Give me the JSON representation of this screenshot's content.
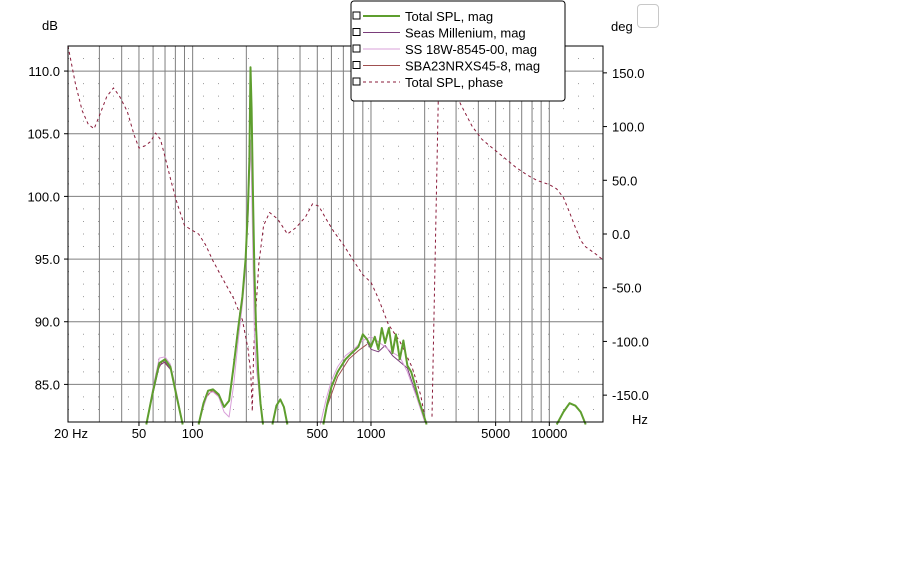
{
  "chart_data": {
    "type": "line",
    "xscale": "log",
    "xlim": [
      20,
      20000
    ],
    "ylim": [
      82,
      112
    ],
    "y2lim": [
      -175,
      175
    ],
    "grid": true,
    "legend_position": "top-right",
    "yunit": "dB",
    "y2unit": "deg",
    "xunit": "Hz",
    "colors": {
      "total_mag": "#5e9e2e",
      "seas": "#7a3d7a",
      "ss": "#d9a0d9",
      "sba": "#a05050",
      "phase": "#8a1b3a"
    },
    "x_ticks": [
      {
        "value": 20,
        "label": "20 Hz"
      },
      {
        "value": 50,
        "label": "50"
      },
      {
        "value": 100,
        "label": "100"
      },
      {
        "value": 500,
        "label": "500"
      },
      {
        "value": 1000,
        "label": "1000"
      },
      {
        "value": 5000,
        "label": "5000"
      },
      {
        "value": 10000,
        "label": "10000"
      }
    ],
    "y_ticks": [
      {
        "value": 110,
        "label": "110.0"
      },
      {
        "value": 105,
        "label": "105.0"
      },
      {
        "value": 100,
        "label": "100.0"
      },
      {
        "value": 95,
        "label": "95.0"
      },
      {
        "value": 90,
        "label": "90.0"
      },
      {
        "value": 85,
        "label": "85.0"
      }
    ],
    "y2_ticks": [
      {
        "value": 150,
        "label": "150.0"
      },
      {
        "value": 100,
        "label": "100.0"
      },
      {
        "value": 50,
        "label": "50.0"
      },
      {
        "value": 0,
        "label": "0.0"
      },
      {
        "value": -50,
        "label": "-50.0"
      },
      {
        "value": -100,
        "label": "-100.0"
      },
      {
        "value": -150,
        "label": "-150.0"
      }
    ],
    "series": [
      {
        "name": "Total SPL, mag",
        "color_key": "total_mag",
        "axis": "left",
        "style": "solid",
        "segments": [
          [
            [
              55,
              81.8
            ],
            [
              60,
              84.5
            ],
            [
              65,
              86.7
            ],
            [
              70,
              87.0
            ],
            [
              75,
              86.4
            ],
            [
              80,
              84.5
            ],
            [
              88,
              81.8
            ]
          ],
          [
            [
              108,
              81.8
            ],
            [
              115,
              83.5
            ],
            [
              122,
              84.5
            ],
            [
              130,
              84.6
            ],
            [
              140,
              84.2
            ],
            [
              150,
              83.2
            ],
            [
              160,
              83.7
            ],
            [
              170,
              86.5
            ],
            [
              180,
              89.5
            ],
            [
              190,
              92.0
            ],
            [
              198,
              95.0
            ],
            [
              204,
              99.0
            ],
            [
              208,
              103.0
            ],
            [
              211,
              110.3
            ],
            [
              214,
              107.0
            ],
            [
              218,
              100.0
            ],
            [
              222,
              94.0
            ],
            [
              227,
              89.5
            ],
            [
              233,
              86.0
            ],
            [
              240,
              83.5
            ],
            [
              248,
              81.8
            ]
          ],
          [
            [
              280,
              81.8
            ],
            [
              295,
              83.3
            ],
            [
              310,
              83.8
            ],
            [
              325,
              83.2
            ],
            [
              340,
              81.8
            ]
          ],
          [
            [
              540,
              81.8
            ],
            [
              570,
              83.5
            ],
            [
              600,
              84.8
            ],
            [
              650,
              86.0
            ],
            [
              720,
              87.0
            ],
            [
              780,
              87.5
            ],
            [
              850,
              88.0
            ],
            [
              900,
              89.0
            ],
            [
              950,
              88.6
            ],
            [
              1000,
              88.0
            ],
            [
              1050,
              88.8
            ],
            [
              1100,
              87.8
            ],
            [
              1150,
              89.5
            ],
            [
              1200,
              88.3
            ],
            [
              1260,
              89.5
            ],
            [
              1320,
              87.5
            ],
            [
              1380,
              89.0
            ],
            [
              1450,
              87.0
            ],
            [
              1520,
              88.5
            ],
            [
              1600,
              86.5
            ],
            [
              1680,
              86.0
            ],
            [
              1760,
              85.0
            ],
            [
              1850,
              83.8
            ],
            [
              1950,
              82.8
            ],
            [
              2050,
              81.8
            ]
          ],
          [
            [
              11000,
              81.8
            ],
            [
              12000,
              82.8
            ],
            [
              13000,
              83.5
            ],
            [
              14000,
              83.3
            ],
            [
              15000,
              82.8
            ],
            [
              16000,
              81.8
            ]
          ]
        ]
      },
      {
        "name": "Seas Millenium, mag",
        "color_key": "seas",
        "axis": "left",
        "style": "solid",
        "segments": [
          [
            [
              60,
              84.3
            ],
            [
              65,
              86.5
            ],
            [
              70,
              86.8
            ],
            [
              75,
              86.2
            ]
          ],
          [
            [
              950,
              88.4
            ],
            [
              1000,
              87.8
            ],
            [
              1100,
              87.6
            ],
            [
              1200,
              88.1
            ],
            [
              1320,
              87.3
            ],
            [
              1450,
              86.8
            ],
            [
              1600,
              86.3
            ],
            [
              1850,
              83.6
            ],
            [
              2050,
              81.9
            ]
          ]
        ]
      },
      {
        "name": "SS 18W-8545-00, mag",
        "color_key": "ss",
        "axis": "left",
        "style": "solid",
        "segments": [
          [
            [
              55,
              81.8
            ],
            [
              60,
              84.8
            ],
            [
              65,
              87.1
            ],
            [
              70,
              87.2
            ],
            [
              75,
              86.6
            ],
            [
              80,
              84.8
            ],
            [
              88,
              81.9
            ]
          ],
          [
            [
              108,
              81.8
            ],
            [
              115,
              83.2
            ],
            [
              122,
              84.3
            ],
            [
              130,
              84.4
            ],
            [
              140,
              84.0
            ],
            [
              150,
              82.8
            ],
            [
              160,
              82.4
            ],
            [
              170,
              85.0
            ],
            [
              180,
              88.5
            ],
            [
              190,
              91.4
            ],
            [
              198,
              94.2
            ],
            [
              204,
              98.0
            ],
            [
              208,
              101.5
            ],
            [
              211,
              104.5
            ],
            [
              214,
              101.0
            ],
            [
              218,
              95.0
            ],
            [
              222,
              89.0
            ],
            [
              227,
              86.5
            ],
            [
              233,
              85.0
            ],
            [
              240,
              83.2
            ],
            [
              248,
              81.8
            ]
          ],
          [
            [
              520,
              81.8
            ],
            [
              560,
              83.8
            ],
            [
              600,
              85.3
            ],
            [
              650,
              86.4
            ],
            [
              720,
              87.3
            ],
            [
              800,
              87.8
            ],
            [
              900,
              88.5
            ],
            [
              1000,
              88.8
            ],
            [
              1100,
              88.4
            ],
            [
              1200,
              88.0
            ],
            [
              1300,
              87.6
            ],
            [
              1450,
              87.2
            ],
            [
              1600,
              86.0
            ],
            [
              1800,
              84.0
            ],
            [
              2000,
              82.0
            ]
          ]
        ]
      },
      {
        "name": "SBA23NRXS45-8, mag",
        "color_key": "sba",
        "axis": "left",
        "style": "solid",
        "segments": [
          [
            [
              62,
              85.8
            ],
            [
              68,
              86.9
            ],
            [
              74,
              86.3
            ]
          ],
          [
            [
              118,
              83.9
            ],
            [
              128,
              84.5
            ],
            [
              140,
              84.1
            ]
          ],
          [
            [
              560,
              83.0
            ],
            [
              650,
              85.6
            ],
            [
              750,
              87.0
            ],
            [
              850,
              87.7
            ],
            [
              950,
              88.2
            ]
          ]
        ]
      },
      {
        "name": "Total SPL, phase",
        "color_key": "phase",
        "axis": "right",
        "style": "dashed",
        "segments": [
          [
            [
              20,
              175
            ],
            [
              22,
              140
            ],
            [
              24,
              115
            ],
            [
              26,
              102
            ],
            [
              28,
              98
            ],
            [
              30,
              110
            ],
            [
              33,
              128
            ],
            [
              36,
              136
            ],
            [
              39,
              128
            ],
            [
              43,
              114
            ],
            [
              47,
              92
            ],
            [
              50,
              80
            ],
            [
              54,
              82
            ],
            [
              58,
              86
            ],
            [
              62,
              94
            ],
            [
              66,
              88
            ],
            [
              70,
              72
            ],
            [
              76,
              48
            ],
            [
              82,
              28
            ],
            [
              90,
              8
            ],
            [
              98,
              4
            ],
            [
              108,
              0
            ],
            [
              118,
              -10
            ],
            [
              130,
              -25
            ],
            [
              150,
              -44
            ],
            [
              170,
              -60
            ],
            [
              190,
              -80
            ],
            [
              205,
              -108
            ],
            [
              212,
              -130
            ],
            [
              216,
              -165
            ],
            [
              220,
              -108
            ],
            [
              226,
              -72
            ],
            [
              235,
              -28
            ],
            [
              250,
              8
            ],
            [
              270,
              20
            ],
            [
              300,
              14
            ],
            [
              340,
              0
            ],
            [
              380,
              6
            ],
            [
              430,
              16
            ],
            [
              470,
              28
            ],
            [
              510,
              26
            ],
            [
              560,
              14
            ],
            [
              620,
              2
            ],
            [
              700,
              -10
            ],
            [
              800,
              -25
            ],
            [
              900,
              -38
            ],
            [
              1000,
              -45
            ],
            [
              1100,
              -60
            ],
            [
              1250,
              -84
            ],
            [
              1450,
              -100
            ],
            [
              1700,
              -124
            ],
            [
              1900,
              -150
            ],
            [
              2000,
              -170
            ]
          ],
          [
            [
              2200,
              -170
            ],
            [
              2400,
              150
            ],
            [
              2600,
              155
            ],
            [
              2800,
              140
            ],
            [
              3200,
              120
            ],
            [
              3700,
              100
            ],
            [
              4200,
              88
            ],
            [
              4800,
              80
            ],
            [
              5500,
              72
            ],
            [
              6500,
              62
            ],
            [
              7500,
              55
            ],
            [
              8500,
              50
            ],
            [
              10000,
              46
            ],
            [
              11000,
              42
            ],
            [
              12000,
              34
            ],
            [
              13000,
              20
            ],
            [
              14000,
              6
            ],
            [
              15000,
              -6
            ],
            [
              16000,
              -12
            ],
            [
              18000,
              -18
            ],
            [
              20000,
              -24
            ]
          ]
        ]
      }
    ]
  }
}
